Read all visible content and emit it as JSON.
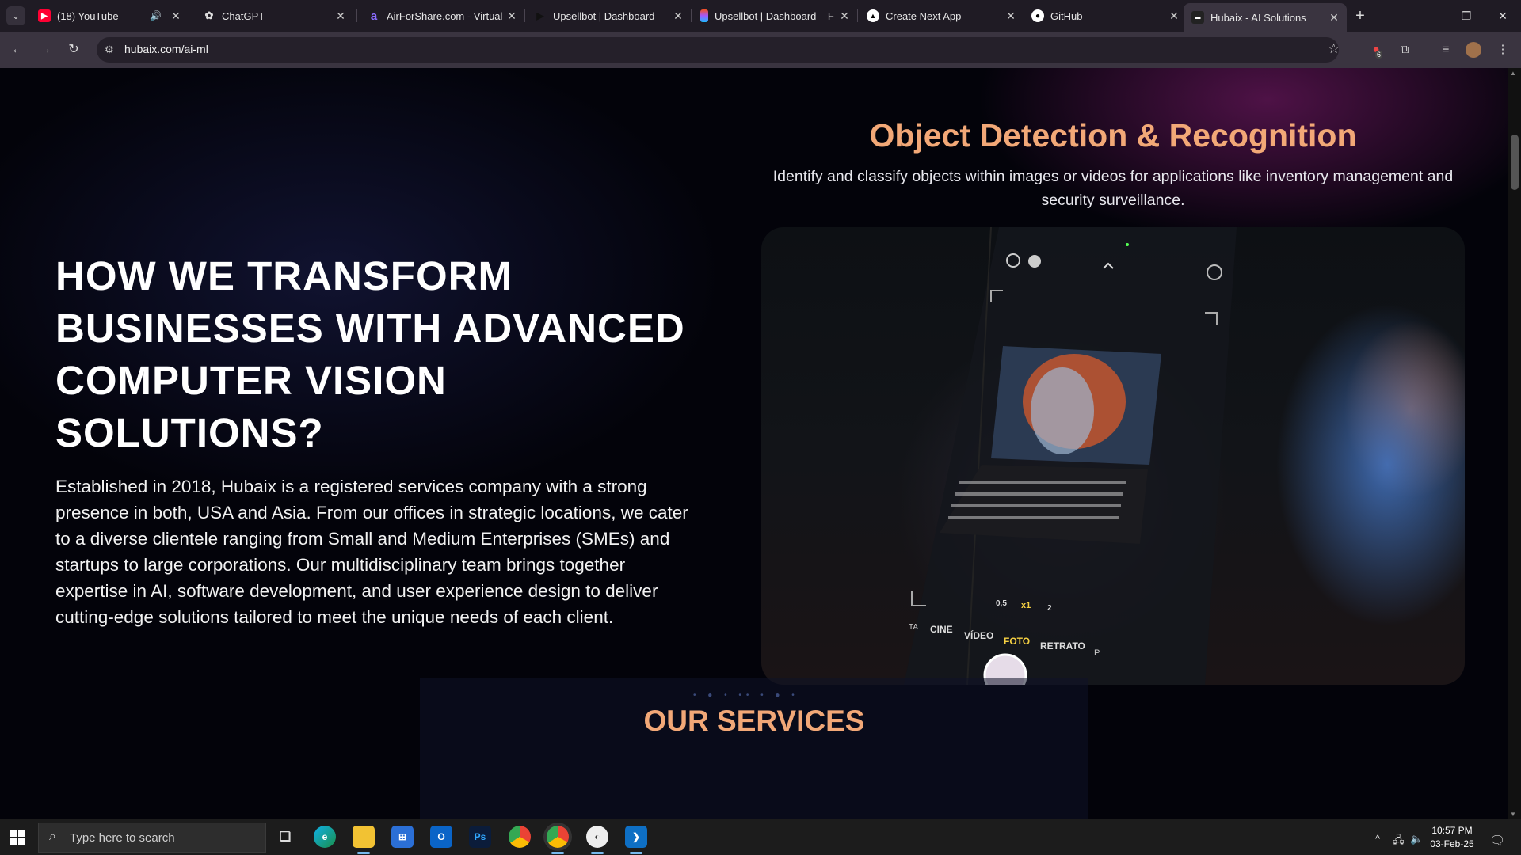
{
  "browser": {
    "tabs": [
      {
        "title": "(18) YouTube",
        "favicon": "youtube-icon",
        "audio": true
      },
      {
        "title": "ChatGPT",
        "favicon": "chatgpt-icon"
      },
      {
        "title": "AirForShare.com - Virtual",
        "favicon": "airforshare-icon"
      },
      {
        "title": "Upsellbot | Dashboard",
        "favicon": "play-icon"
      },
      {
        "title": "Upsellbot | Dashboard – F",
        "favicon": "figma-icon"
      },
      {
        "title": "Create Next App",
        "favicon": "vercel-icon"
      },
      {
        "title": "GitHub",
        "favicon": "github-icon"
      },
      {
        "title": "Hubaix - AI Solutions",
        "favicon": "hubaix-icon",
        "active": true
      }
    ],
    "url": "hubaix.com/ai-ml",
    "extension_badge": "6"
  },
  "page": {
    "hero": {
      "heading": "HOW WE TRANSFORM BUSINESSES WITH ADVANCED COMPUTER VISION SOLUTIONS?",
      "body": "Established in 2018, Hubaix is a registered services company with a strong presence in both, USA and Asia. From our offices in strategic locations, we cater to a diverse clientele ranging from Small and Medium Enterprises (SMEs) and startups to large corporations. Our multidisciplinary team brings together expertise in AI, software development, and user experience design to deliver cutting-edge solutions tailored to meet the unique needs of each client."
    },
    "feature": {
      "title": "Object Detection & Recognition",
      "description": "Identify and classify objects within images or videos for applications like inventory management and security surveillance.",
      "image_labels": {
        "zoom_levels": [
          "0,5",
          "x1",
          "2"
        ],
        "camera_modes": [
          "TA",
          "CINE",
          "VÍDEO",
          "FOTO",
          "RETRATO",
          "P"
        ]
      }
    },
    "services": {
      "title": "OUR SERVICES"
    }
  },
  "taskbar": {
    "search_placeholder": "Type here to search",
    "time": "10:57 PM",
    "date": "03-Feb-25"
  },
  "colors": {
    "accent": "#f2a877",
    "page_background": "#03030a",
    "chrome_background": "#3a3440"
  }
}
